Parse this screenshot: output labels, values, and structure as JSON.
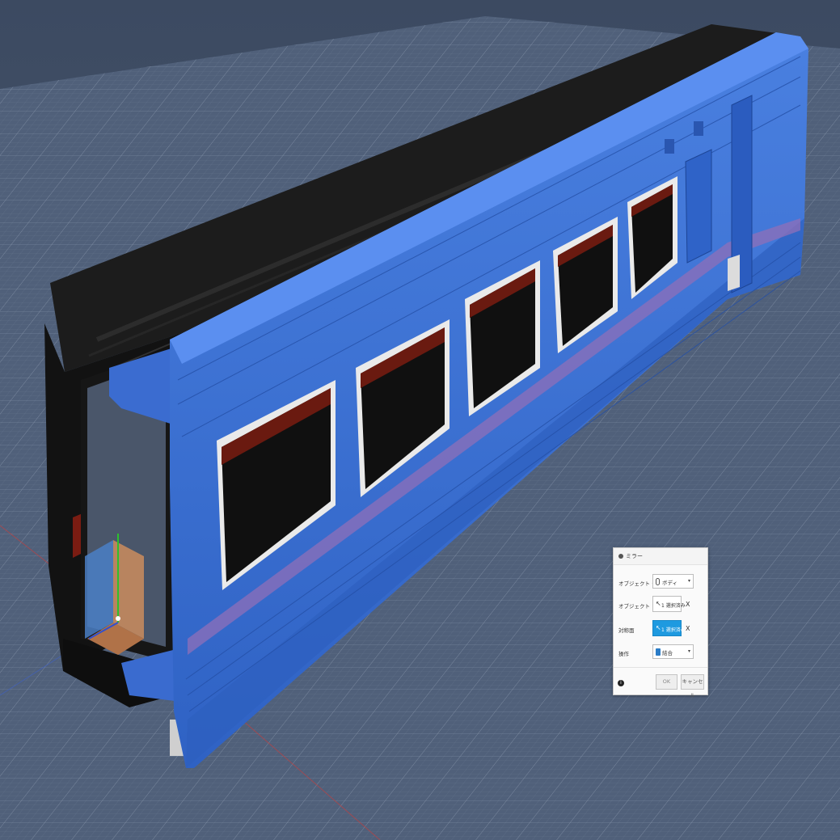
{
  "viewport": {
    "background_color": "#4a5a72",
    "body_color": "#3b6ed0",
    "window_count": 5
  },
  "mirror_dialog": {
    "title": "ミラー",
    "header_icon": "mirror-icon",
    "object_type": {
      "label": "オブジェクト タイプ",
      "value": "ボディ",
      "icon": "body-icon"
    },
    "objects": {
      "label": "オブジェクト",
      "value": "1 選択済み",
      "icon": "cursor-icon"
    },
    "mirror_plane": {
      "label": "対称面",
      "value": "1 選択済み",
      "icon": "cursor-icon"
    },
    "operation": {
      "label": "操作",
      "value": "結合",
      "icon": "join-icon"
    },
    "clear_symbol": "X",
    "info_symbol": "i",
    "ok_label": "OK",
    "cancel_label": "キャンセル",
    "accent_color": "#1e9ae0"
  }
}
